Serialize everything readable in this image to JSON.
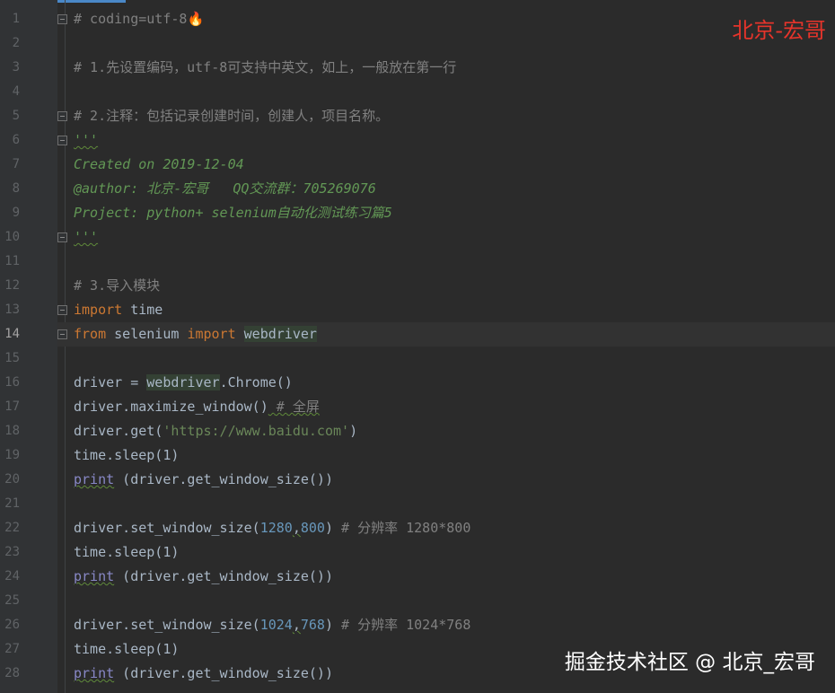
{
  "watermark": {
    "top": "北京-宏哥",
    "bottom": "掘金技术社区 @ 北京_宏哥"
  },
  "editor": {
    "current_line": 14,
    "line_numbers": [
      "1",
      "2",
      "3",
      "4",
      "5",
      "6",
      "7",
      "8",
      "9",
      "10",
      "11",
      "12",
      "13",
      "14",
      "15",
      "16",
      "17",
      "18",
      "19",
      "20",
      "21",
      "22",
      "23",
      "24",
      "25",
      "26",
      "27",
      "28"
    ],
    "code": {
      "l1": "# coding=utf-8",
      "l1_icon": "🔥",
      "l3": "# 1.先设置编码，utf-8可支持中英文，如上，一般放在第一行",
      "l5": "# 2.注释：包括记录创建时间，创建人，项目名称。",
      "l6": "'''",
      "l7": "Created on 2019-12-04",
      "l8": "@author: 北京-宏哥   QQ交流群：705269076",
      "l9": "Project: python+ selenium自动化测试练习篇5",
      "l10": "'''",
      "l12": "# 3.导入模块",
      "l13_kw": "import",
      "l13_rest": " time",
      "l14_kw1": "from",
      "l14_mid": " selenium ",
      "l14_kw2": "import",
      "l14_sp": " ",
      "l14_mod": "webdriver",
      "l16_a": "driver = ",
      "l16_mod": "webdriver",
      "l16_b": ".Chrome()",
      "l17_a": "driver.maximize_window()",
      "l17_cm": " # 全屏",
      "l18_a": "driver.get(",
      "l18_str": "'https://www.baidu.com'",
      "l18_b": ")",
      "l19": "time.sleep(1)",
      "l20_fn": "print",
      "l20_rest": " (driver.get_window_size())",
      "l22_a": "driver.set_window_size(",
      "l22_n1": "1280",
      "l22_comma": ",",
      "l22_n2": "800",
      "l22_b": ")",
      "l22_cm": " # 分辨率 1280*800",
      "l23": "time.sleep(1)",
      "l24_fn": "print",
      "l24_rest": " (driver.get_window_size())",
      "l26_a": "driver.set_window_size(",
      "l26_n1": "1024",
      "l26_comma": ",",
      "l26_n2": "768",
      "l26_b": ")",
      "l26_cm": " # 分辨率 1024*768",
      "l27": "time.sleep(1)",
      "l28_fn": "print",
      "l28_rest": " (driver.get_window_size())"
    }
  }
}
